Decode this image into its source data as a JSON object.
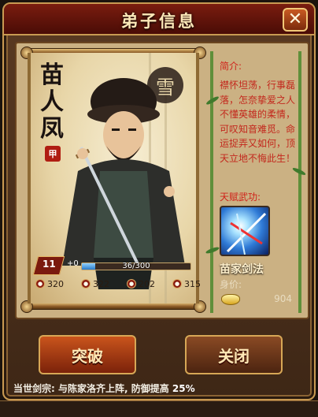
{
  "window": {
    "title": "弟子信息",
    "close_label": "✕"
  },
  "portrait": {
    "name": "苗人凤",
    "grade_seal": "甲",
    "seal_mark": "雪",
    "level": "11",
    "plus": "+0",
    "exp_text": "36/300",
    "exp_fraction": 0.12,
    "attrs": [
      "320",
      "322",
      "202",
      "315"
    ]
  },
  "info": {
    "intro_head": "简介:",
    "intro_text": "襟怀坦荡，行事磊落，怎奈挚爱之人不懂英雄的柔情，可叹知音难觅。命运捉弄又如何，顶天立地不悔此生！",
    "skill_head": "天赋武功:",
    "skill_name": "苗家剑法",
    "value_label": "身价:",
    "value": "904"
  },
  "buttons": {
    "breakthrough": "突破",
    "close": "关闭"
  },
  "hint": {
    "text": "当世剑宗: 与陈家洛齐上阵, 防御提高",
    "percent": "25%"
  },
  "colors": {
    "accent": "#7a1d0f",
    "gold": "#c99a52",
    "red_text": "#c3281d"
  }
}
